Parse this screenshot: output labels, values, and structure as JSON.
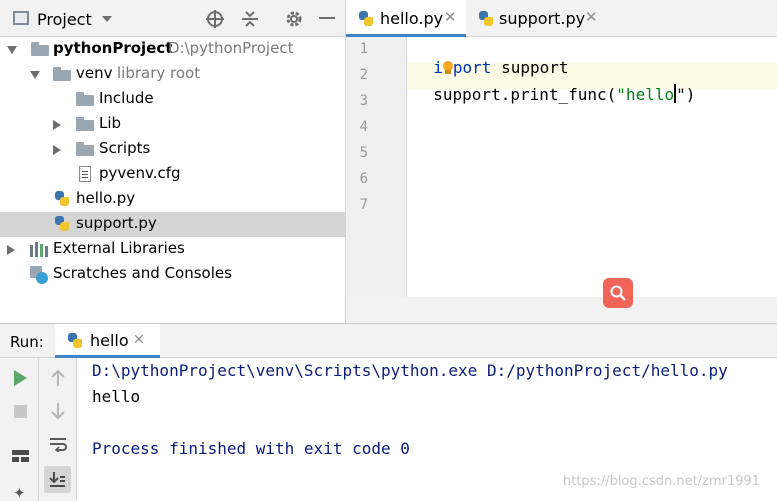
{
  "project_panel": {
    "title": "Project",
    "tree": [
      {
        "label": "pythonProject",
        "note": "D:\\pythonProject"
      },
      {
        "label": "venv",
        "note": "library root"
      },
      {
        "label": "Include"
      },
      {
        "label": "Lib"
      },
      {
        "label": "Scripts"
      },
      {
        "label": "pyvenv.cfg"
      },
      {
        "label": "hello.py"
      },
      {
        "label": "support.py"
      },
      {
        "label": "External Libraries"
      },
      {
        "label": "Scratches and Consoles"
      }
    ]
  },
  "editor": {
    "tabs": [
      {
        "label": "hello.py"
      },
      {
        "label": "support.py"
      }
    ],
    "line_numbers": [
      "1",
      "2",
      "3",
      "4",
      "5",
      "6",
      "7"
    ],
    "code": {
      "line1_kw_a": "i",
      "line1_kw_b": "port",
      "line1_rest": " support",
      "line2_a": "support.print_func(",
      "line2_str": "\"hello",
      "line2_b": "\")"
    }
  },
  "run_panel": {
    "label": "Run:",
    "tab": "hello",
    "output": {
      "command": "D:\\pythonProject\\venv\\Scripts\\python.exe D:/pythonProject/hello.py",
      "stdout": "hello",
      "exit": "Process finished with exit code 0"
    }
  },
  "watermark": "https://blog.csdn.net/zmr1991",
  "colors": {
    "accent": "#4083c9",
    "keyword": "#0033b3",
    "string": "#067d17",
    "selection": "#d5d5d5",
    "console_text": "#0b1c7a"
  }
}
